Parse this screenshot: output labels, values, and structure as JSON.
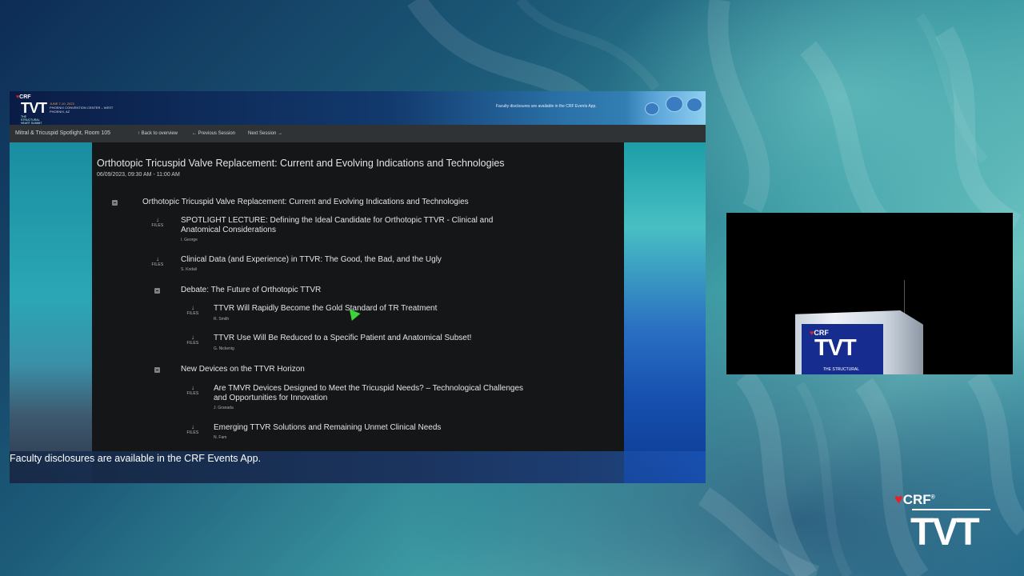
{
  "slide": {
    "banner": {
      "crf": "CRF",
      "tvt": "TVT",
      "subtitle": "THE STRUCTURAL HEART SUMMIT",
      "event_dates": "JUNE 7-10, 2023",
      "event_venue": "PHOENIX CONVENTION CENTER – WEST",
      "event_city": "PHOENIX, AZ",
      "disclosure": "Faculty disclosures are available in the CRF Events App."
    },
    "nav": {
      "room": "Mitral & Tricuspid Spotlight, Room 105",
      "back": "↑ Back to overview",
      "previous": "← Previous Session",
      "next": "Next Session →"
    },
    "session": {
      "title": "Orthotopic Tricuspid Valve Replacement: Current and Evolving Indications and Technologies",
      "date": "06/09/2023, 09:30 AM - 11:00 AM"
    },
    "files_label": "FILES",
    "files_arrow": "↓",
    "agenda": {
      "main": "Orthotopic Tricuspid Valve Replacement: Current and Evolving Indications and Technologies",
      "talk1": {
        "title": "SPOTLIGHT LECTURE: Defining the Ideal Candidate for Orthotopic TTVR - Clinical and Anatomical Considerations",
        "speaker": "I. George"
      },
      "talk2": {
        "title": "Clinical Data (and Experience) in TTVR: The Good, the Bad, and the Ugly",
        "speaker": "S. Kodali"
      },
      "debate": "Debate: The Future of Orthotopic TTVR",
      "talk3": {
        "title": "TTVR Will Rapidly Become the Gold Standard of TR Treatment",
        "speaker": "R. Smith"
      },
      "talk4": {
        "title": "TTVR Use Will Be Reduced to a Specific Patient and Anatomical Subset!",
        "speaker": "G. Nickenig"
      },
      "devices": "New Devices on the TTVR Horizon",
      "talk5": {
        "title": "Are TMVR Devices Designed to Meet the Tricuspid Needs? – Technological Challenges and Opportunities for Innovation",
        "speaker": "J. Granada"
      },
      "talk6": {
        "title": "Emerging TTVR Solutions and Remaining Unmet Clinical Needs",
        "speaker": "N. Fam"
      }
    },
    "footer": "Faculty disclosures are available in the CRF Events App."
  },
  "video": {
    "podium_crf": "CRF",
    "podium_tvt": "TVT",
    "podium_sub": "THE STRUCTURAL"
  },
  "logo": {
    "crf": "CRF",
    "reg": "®",
    "tvt": "TVT"
  },
  "colors": {
    "crf_red": "#e0232b",
    "podium_blue": "#162d8f",
    "content_bg": "#141618",
    "cursor_green": "#3bd43b"
  }
}
